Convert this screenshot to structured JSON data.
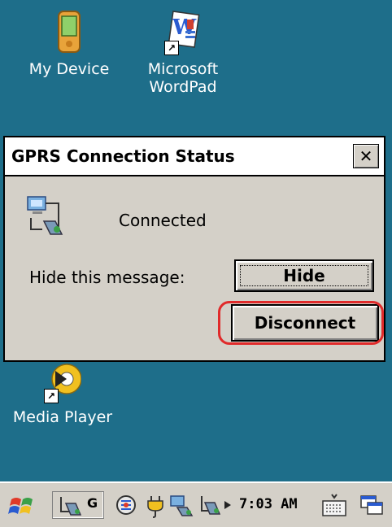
{
  "desktop": {
    "icons": [
      {
        "label_lines": [
          "My Device"
        ],
        "icon": "pda-device-icon"
      },
      {
        "label_lines": [
          "Microsoft",
          "WordPad"
        ],
        "icon": "wordpad-icon"
      },
      {
        "label_lines": [
          "Media Player"
        ],
        "icon": "media-player-icon"
      }
    ]
  },
  "dialog": {
    "title": "GPRS Connection Status",
    "close_glyph": "✕",
    "status_icon": "network-connection-icon",
    "status_text": "Connected",
    "hide_message_label": "Hide this message:",
    "hide_button_label": "Hide",
    "disconnect_button_label": "Disconnect",
    "highlight_color": "#e02a2a"
  },
  "taskbar": {
    "start_icon": "windows-flag-icon",
    "gprs_indicator": "G",
    "clock": "7:03 AM",
    "tray_icons": [
      "network-icon",
      "power-plug-icon",
      "sync-icon",
      "connectivity-icon",
      "keyboard-input-icon",
      "desktop-switch-icon"
    ]
  },
  "colors": {
    "desktop_bg": "#1e6e8a",
    "dialog_bg": "#d4d0c8",
    "title_bg": "#ffffff"
  }
}
